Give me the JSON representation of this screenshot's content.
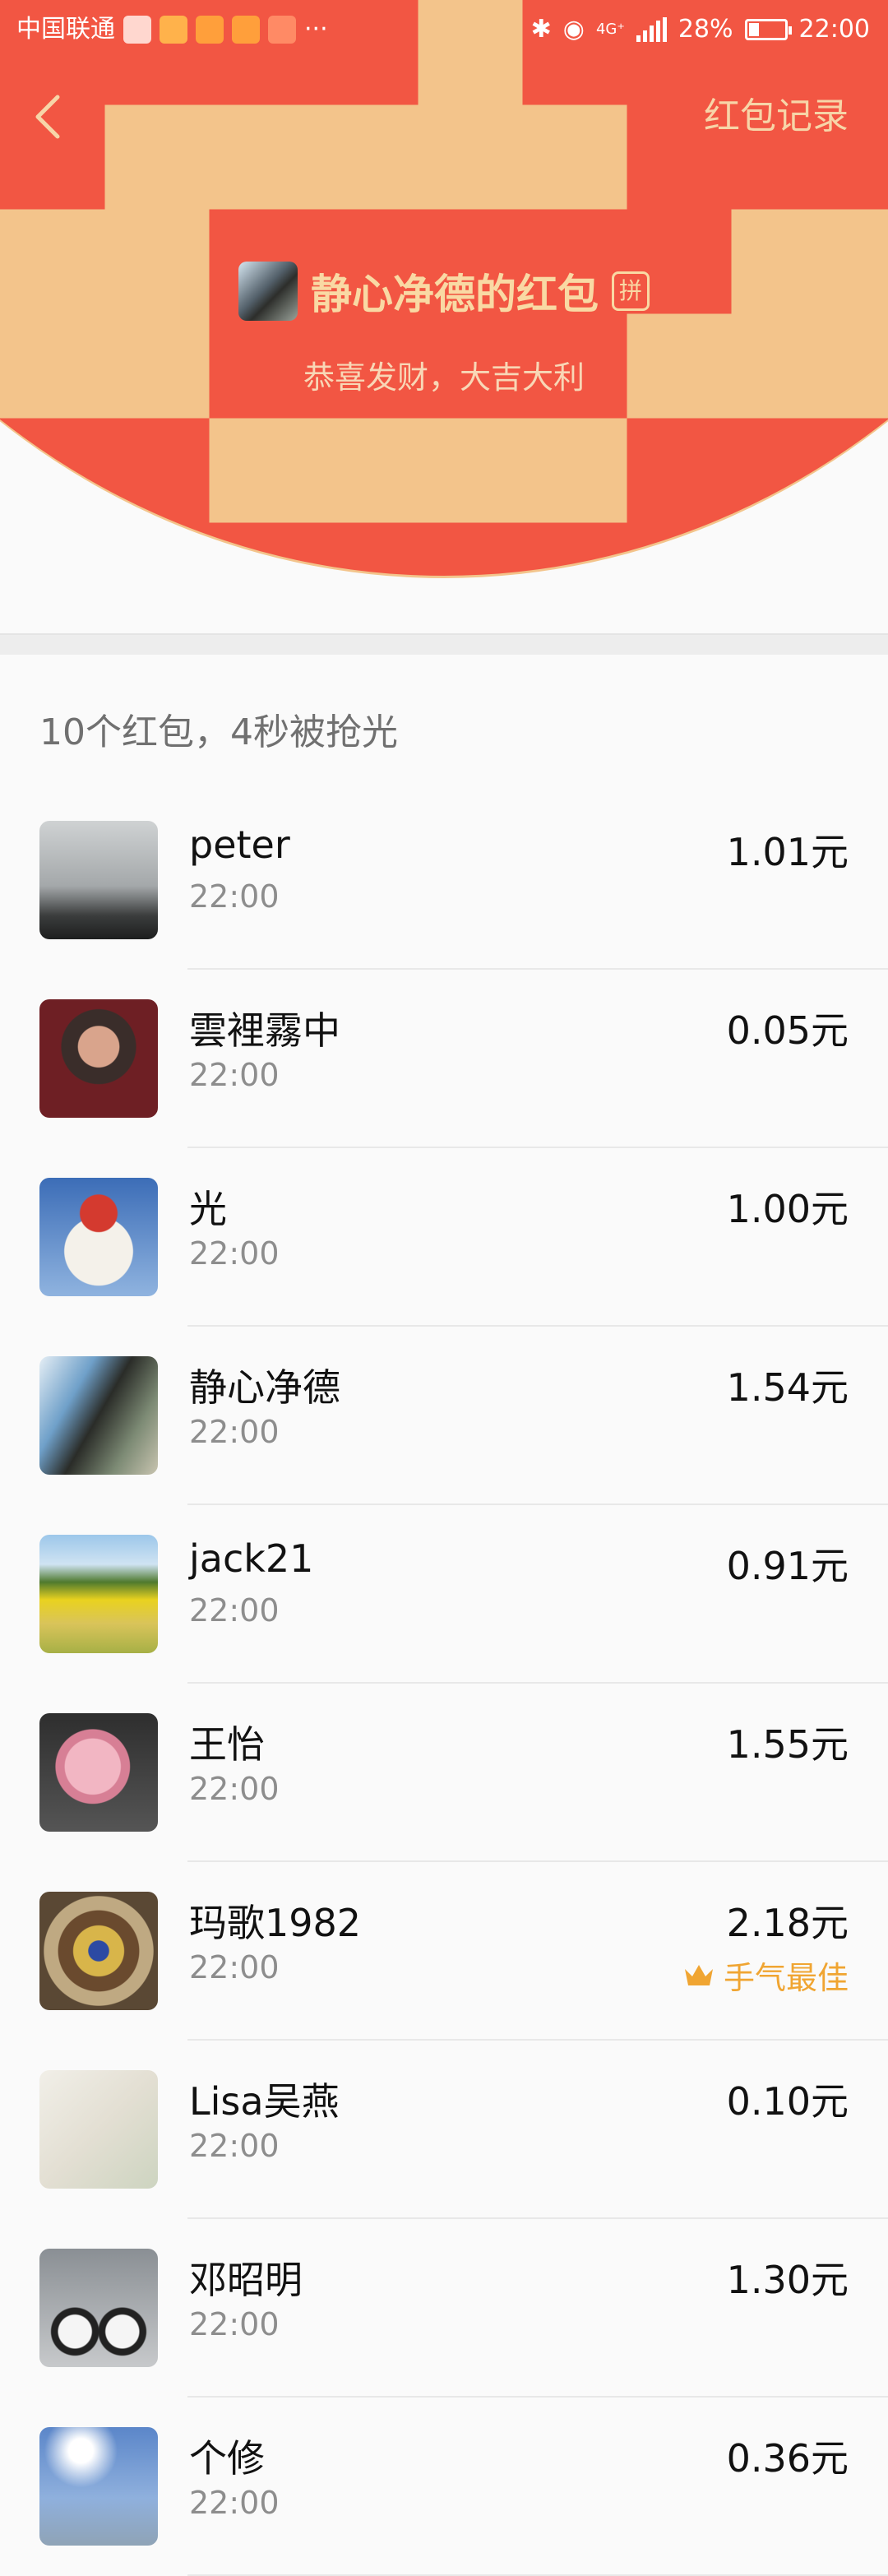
{
  "status_bar": {
    "carrier": "中国联通",
    "more": "···",
    "network": "4G⁺",
    "battery": "28%",
    "time": "22:00"
  },
  "nav": {
    "record_label": "红包记录"
  },
  "header": {
    "title": "静心净德的红包",
    "badge": "拼",
    "subtitle": "恭喜发财，大吉大利"
  },
  "summary": "10个红包，4秒被抢光",
  "colors": {
    "header_red": "#f25643",
    "gold": "#f9d9a4",
    "best_orange": "#f0a532"
  },
  "records": [
    {
      "name": "peter",
      "time": "22:00",
      "amount": "1.01元"
    },
    {
      "name": "雲裡霧中",
      "time": "22:00",
      "amount": "0.05元"
    },
    {
      "name": "光",
      "time": "22:00",
      "amount": "1.00元"
    },
    {
      "name": "静心净德",
      "time": "22:00",
      "amount": "1.54元"
    },
    {
      "name": "jack21",
      "time": "22:00",
      "amount": "0.91元"
    },
    {
      "name": "王怡",
      "time": "22:00",
      "amount": "1.55元"
    },
    {
      "name": "玛歌1982",
      "time": "22:00",
      "amount": "2.18元",
      "best": "手气最佳"
    },
    {
      "name": "Lisa吴燕",
      "time": "22:00",
      "amount": "0.10元"
    },
    {
      "name": "邓昭明",
      "time": "22:00",
      "amount": "1.30元"
    },
    {
      "name": "个修",
      "time": "22:00",
      "amount": "0.36元"
    }
  ]
}
